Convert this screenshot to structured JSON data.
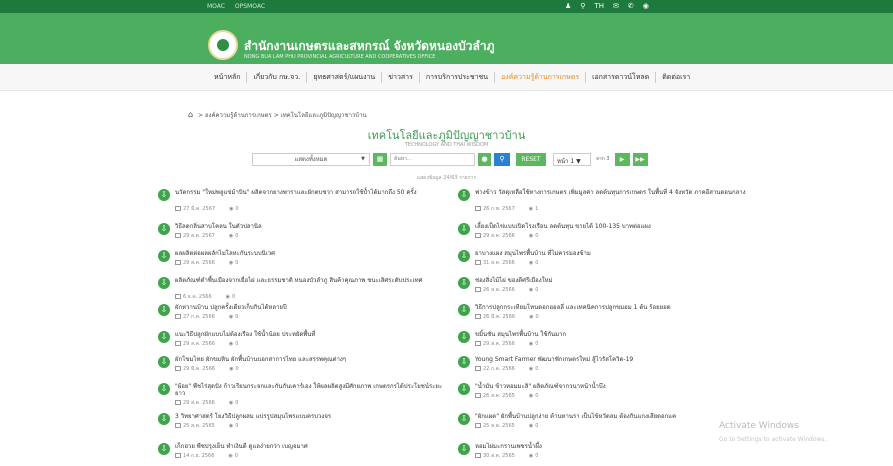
{
  "topbar": {
    "links": [
      "MOAC",
      "OPSMOAC"
    ],
    "icons": [
      "user-icon",
      "search-icon",
      "language-icon",
      "mail-icon",
      "phone-icon",
      "location-icon"
    ],
    "language": "TH"
  },
  "header": {
    "title": "สำนักงานเกษตรและสหกรณ์ จังหวัดหนองบัวลำภู",
    "subtitle": "NONG BUA LAM PHU PROVINCIAL AGRICULTURE AND COOPERATIVES OFFICE"
  },
  "nav": {
    "items": [
      "หน้าหลัก",
      "เกี่ยวกับ กษ.จว.",
      "ยุทธศาสตร์/แผนงาน",
      "ข่าวสาร",
      "การบริการประชาชน",
      "องค์ความรู้ด้านการเกษตร",
      "เอกสารดาวน์โหลด",
      "ติดต่อเรา"
    ],
    "active_index": 5
  },
  "breadcrumb": {
    "items": [
      "องค์ความรู้ด้านการเกษตร",
      "เทคโนโลยีและภูมิปัญญาชาวบ้าน"
    ]
  },
  "page": {
    "title": "เทคโนโลยีและภูมิปัญญาชาวบ้าน",
    "subtitle": "TECHNOLOGY AND THAI WISDOM"
  },
  "filters": {
    "select_value": "แสดงทั้งหมด",
    "search_placeholder": "ค้นหา...",
    "reset_label": "RESET",
    "page_select": "หน้า 1",
    "page_of": "จาก 3"
  },
  "count_text": "แสดงข้อมูล 24/63 รายการ",
  "items": [
    {
      "title": "นวัตกรรม \"ใหม่พลูแข่ม้าบิน\" ผลิตจากยางพาราและผักตบชวา สามารถใช้ป้ำได้มากถึง 50 ครั้ง",
      "date": "27 มี.ค. 2567",
      "views": "0"
    },
    {
      "title": "ฟางข้าว วัสดุเหลือใช้ทางการเกษตร เพิ่มมูลค่า ลดต้นทุนการเกษตร ในพื้นที่ 4 จังหวัด ภาคอีสานตอนกลาง",
      "date": "26 ก.พ. 2567",
      "views": "1"
    },
    {
      "title": "วิธีลดกลิ่นสาบโคลน ในตัวปลานิล",
      "date": "29 ส.ค. 2567",
      "views": "0"
    },
    {
      "title": "เลี้ยงเป็ดไข่แบบเปิดโรงเรือน ลดต้นทุน ขายได้ 100-135 บาทต่อแผง",
      "date": "29 ส.ค. 2566",
      "views": "0"
    },
    {
      "title": "ผลผลิตต่อผลผลักไม่โลหะกันระบบนิเวศ",
      "date": "29 ส.ค. 2566",
      "views": "0"
    },
    {
      "title": "ยาบางแผง สมุนไพรพื้นบ้าน ที่ไม่ควรมองข้าม",
      "date": "31 ส.ค. 2566",
      "views": "0"
    },
    {
      "title": "ผลิตภัณฑ์ดำพื้นเมืองจากเยื่อไผ่ และธรรมชาติ หนองบัวลำภู สินค้าคุณภาพ ชนะเลิศระดับประเทศ",
      "date": "6 ธ.ค. 2566",
      "views": "0"
    },
    {
      "title": "ช่องสิ่งไม้ไผ่ ของดีศรีเมืองใหม่",
      "date": "26 ส.ค. 2566",
      "views": "0"
    },
    {
      "title": "ผักหวานบ้าน ปลูกครั้งเดียวเก็บกินได้หลายปี",
      "date": "27 ก.ค. 2566",
      "views": "0"
    },
    {
      "title": "วิธีการปลูกกระเทียมโทนดอกฮอลลี่ และเทคนิคการปลูกขมอม 1 ต้น ร้อยยอด",
      "date": "26 มี.ค. 2566",
      "views": "0"
    },
    {
      "title": "แนะวิธีปลูกผักแบบไม่ต้องเรือง ใช้น้ำน้อย ประหยัดพื้นที่",
      "date": "29 ส.ค. 2566",
      "views": "0"
    },
    {
      "title": "ขมิ้นชัน สมุนไพรพื้นบ้าน ใช้กันมาก",
      "date": "29 ส.ค. 2566",
      "views": "0"
    },
    {
      "title": "ผักโขมไทย ผักขมหิน ผักพื้นบ้านบอกสาการไทย และสรรพคุณต่างๆ",
      "date": "29 มี.ค. 2566",
      "views": "0"
    },
    {
      "title": "Young Smart Farmer พัฒนาฟักเกษตรใหม่ สู้ไวรัสโควิด-19",
      "date": "22 ก.ค. 2566",
      "views": "0"
    },
    {
      "title": "\"ผ้อย\" พืชไร่สุดปัง ก้าวเรียนกระจกและกันกันเคาร์เอง ให้ผลผลิตสูงมีศักยภาพ เกษตรกรได้ประโยชน์ระยะยาว",
      "date": "29 ส.ค. 2566",
      "views": "0"
    },
    {
      "title": "\"น้ำมัน ข้าวหอมมะลิ\" ผลิตภัณฑ์จากวนาหน้าน้ำบึง",
      "date": "26 ส.ค. 2565",
      "views": "0"
    },
    {
      "title": "3 วิทยาศาสตร์ โยงวิธีปลูกผสม แปรรูปสมุนไพรแบบครบวงจร",
      "date": "25 ส.ค. 2565",
      "views": "0"
    },
    {
      "title": "\"ผักแผด\" ผักพื้นบ้านปลูกง่าย ต้านทานรา เป็นไข้หวัดลม ต้องกินแกงเสียดอกแค",
      "date": "25 ส.ค. 2565",
      "views": "0"
    },
    {
      "title": "เก็กฮวย พืชปรุงเย็น ทำเงินดี ดูแลง่ายกว่า เบญจมาศ",
      "date": "14 ก.ย. 2566",
      "views": "0"
    },
    {
      "title": "หอมไผ่มะกรานเพชรน้ำผึ้ง",
      "date": "30 ส.ค. 2565",
      "views": "0"
    }
  ],
  "watermark": {
    "title": "Activate Windows",
    "subtitle": "Go to Settings to activate Windows."
  }
}
